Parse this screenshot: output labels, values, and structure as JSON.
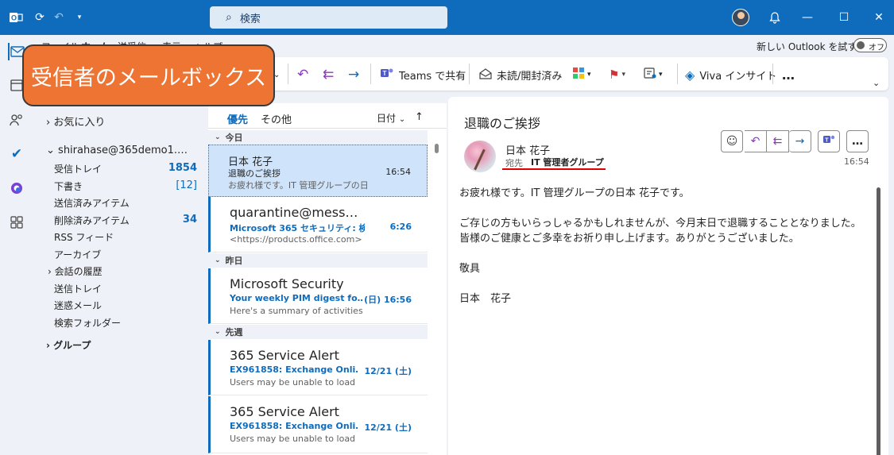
{
  "titlebar": {
    "search_placeholder": "検索",
    "search_icon": "search-icon"
  },
  "menu": {
    "tabs": [
      "ファイル",
      "ホーム",
      "送受信",
      "表示",
      "ヘルプ"
    ]
  },
  "try_outlook": {
    "label": "新しい Outlook を試す",
    "toggle": "オフ"
  },
  "ribbon": {
    "teams_share": "Teams で共有",
    "read_unread": "未読/開封済み",
    "viva": "Viva インサイト",
    "more": "…"
  },
  "folders": {
    "favorites": "お気に入り",
    "account": "shirahase@365demo1.…",
    "items": [
      {
        "label": "受信トレイ",
        "count": "1854"
      },
      {
        "label": "下書き",
        "count": "[12]"
      },
      {
        "label": "送信済みアイテム",
        "count": ""
      },
      {
        "label": "削除済みアイテム",
        "count": "34"
      },
      {
        "label": "RSS フィード",
        "count": ""
      },
      {
        "label": "アーカイブ",
        "count": ""
      },
      {
        "label": "会話の履歴",
        "count": ""
      },
      {
        "label": "送信トレイ",
        "count": ""
      },
      {
        "label": "迷惑メール",
        "count": ""
      },
      {
        "label": "検索フォルダー",
        "count": ""
      }
    ],
    "groups": "グループ"
  },
  "message_list": {
    "tab_focused": "優先",
    "tab_other": "その他",
    "sort": "日付",
    "groups": [
      "今日",
      "昨日",
      "先週"
    ],
    "messages": [
      {
        "from": "日本 花子",
        "subject": "退職のご挨拶",
        "time": "16:54",
        "preview": "お疲れ様です。IT 管理グループの日"
      },
      {
        "from": "quarantine@mess…",
        "subject": "Microsoft 365 セキュリティ: 検…",
        "time": "6:26",
        "preview": "<https://products.office.com>"
      },
      {
        "from": "Microsoft Security",
        "subject": "Your weekly PIM digest fo…",
        "time": "(日) 16:56",
        "preview": "Here's a summary of activities"
      },
      {
        "from": "365 Service Alert",
        "subject": "EX961858: Exchange Onli…",
        "time": "12/21 (土)",
        "preview": "Users may be unable to load"
      },
      {
        "from": "365 Service Alert",
        "subject": "EX961858: Exchange Onli…",
        "time": "12/21 (土)",
        "preview": "Users may be unable to load"
      }
    ]
  },
  "reading": {
    "subject": "退職のご挨拶",
    "from": "日本 花子",
    "to_label": "宛先",
    "to": "IT 管理者グループ",
    "time": "16:54",
    "body": [
      "お疲れ様です。IT 管理グループの日本 花子です。",
      "",
      "ご存じの方もいらっしゃるかもしれませんが、今月末日で退職することとなりました。",
      "皆様のご健康とご多幸をお祈り申し上げます。ありがとうございました。",
      "",
      "敬具",
      "",
      "日本　花子"
    ]
  },
  "callout": "受信者のメールボックス",
  "colors": {
    "accent": "#0f6cbd",
    "callout": "#ee7433",
    "underline": "#e00000"
  }
}
